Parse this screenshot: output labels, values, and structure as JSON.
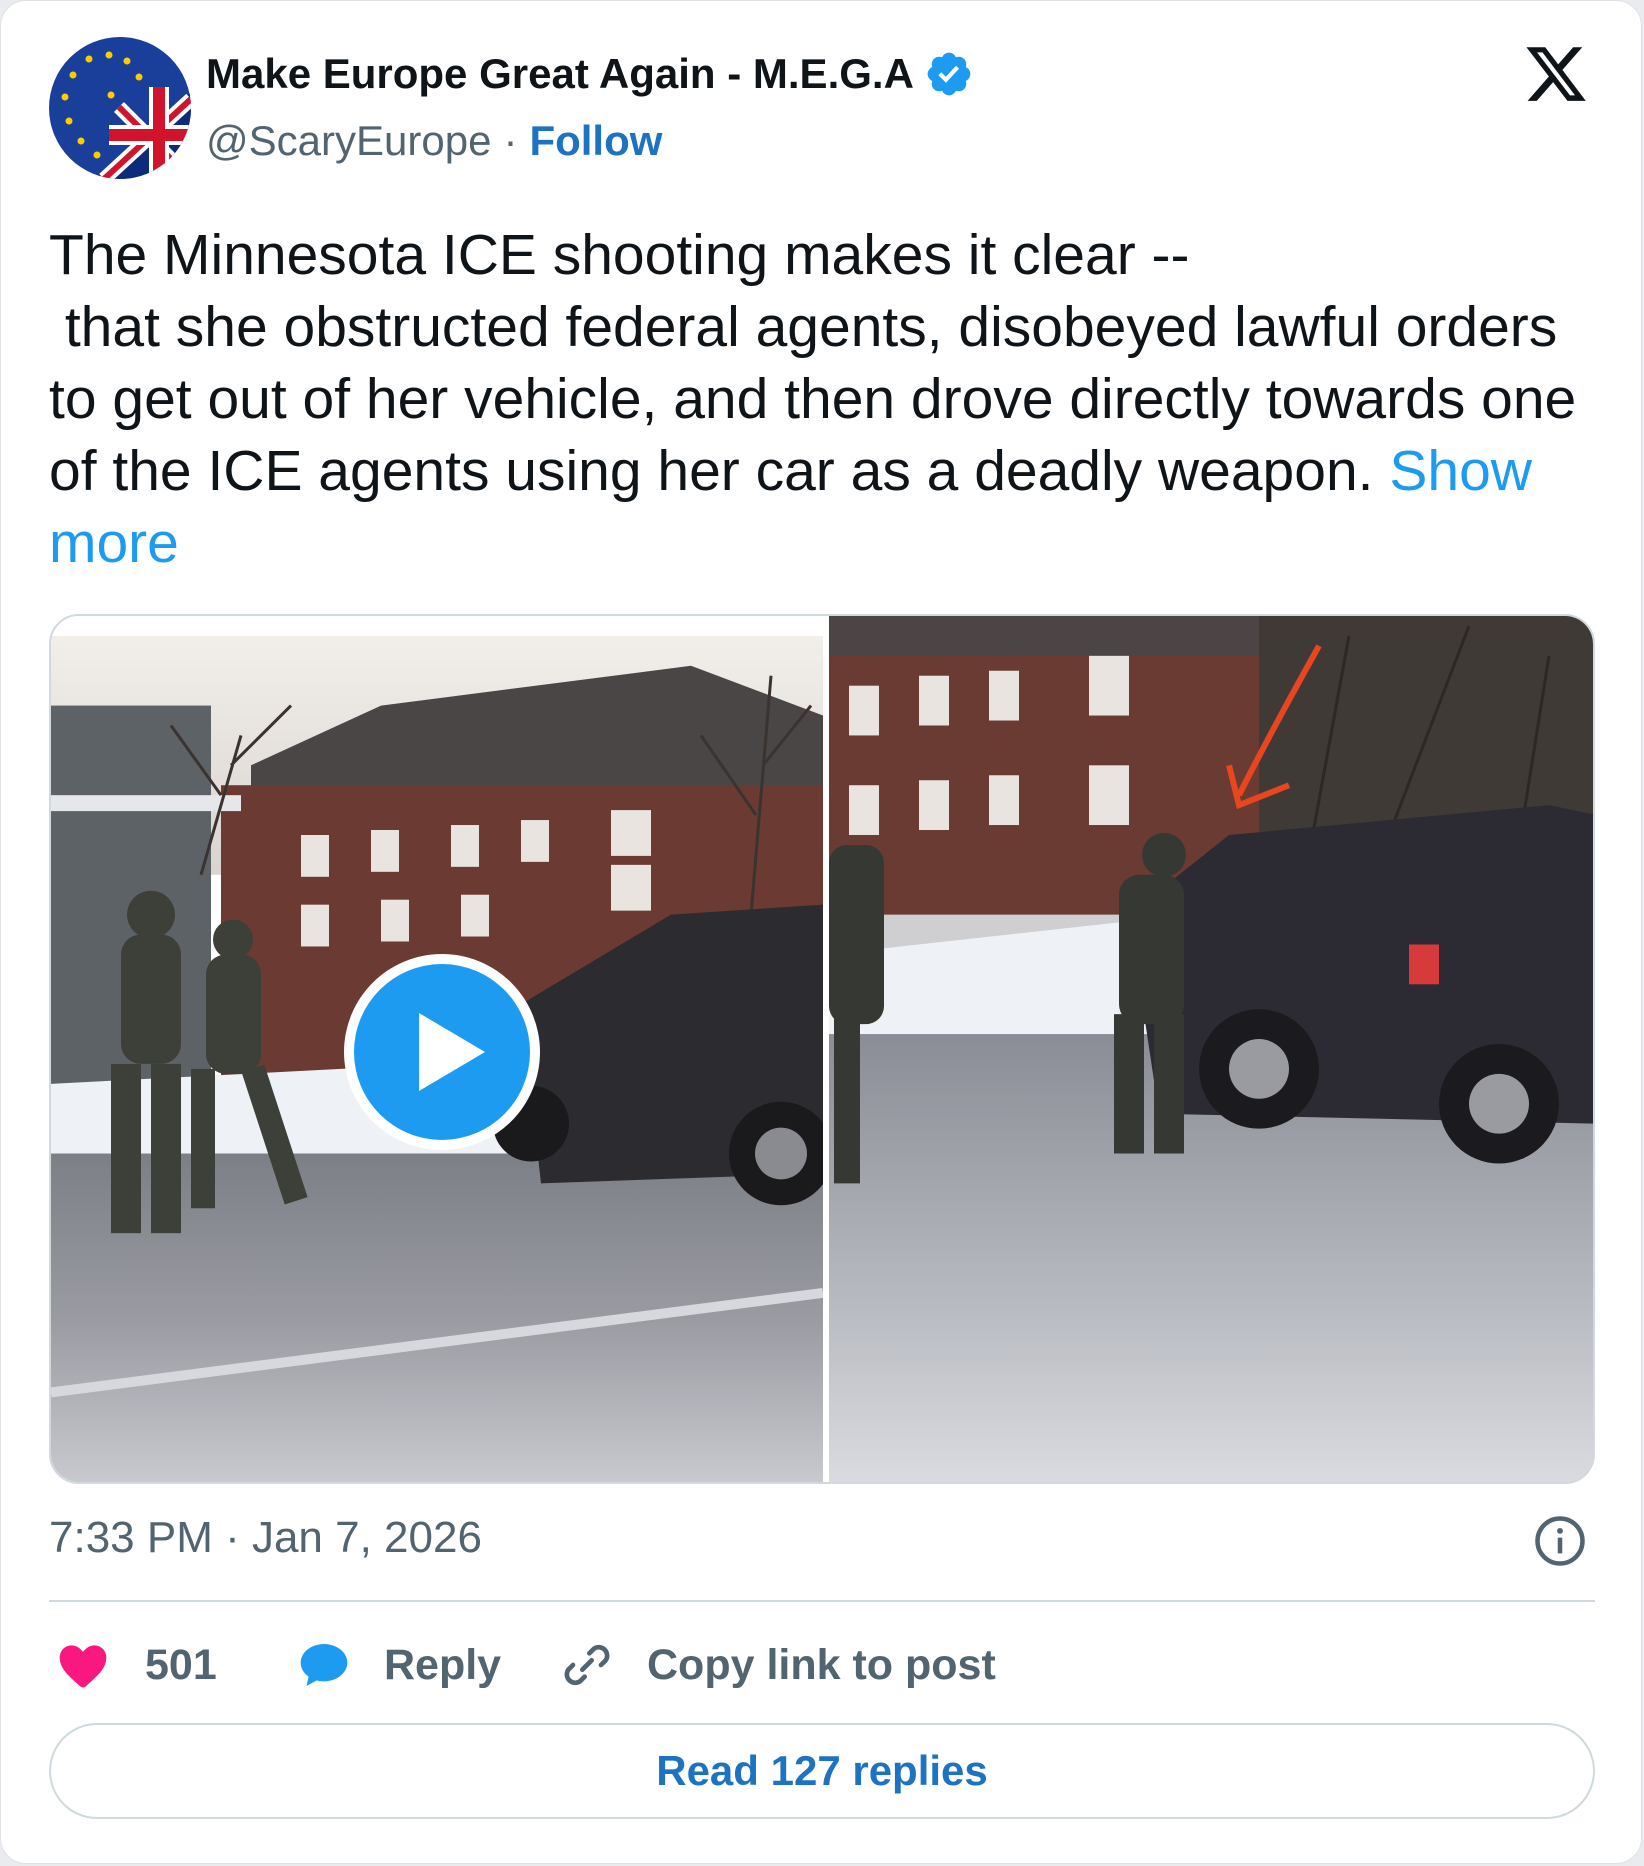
{
  "author": {
    "display_name": "Make Europe Great Again - M.E.G.A",
    "handle": "@ScaryEurope",
    "separator": "·",
    "follow_label": "Follow",
    "verified": true
  },
  "tweet": {
    "text": "The Minnesota ICE shooting makes it clear --\n that she obstructed federal agents, disobeyed lawful orders to get out of her vehicle, and then drove directly towards one of the ICE agents using her car as a deadly weapon. ",
    "show_more_label": "Show more",
    "timestamp": "7:33 PM · Jan 7, 2026"
  },
  "actions": {
    "likes_count": "501",
    "reply_label": "Reply",
    "copy_link_label": "Copy link to post"
  },
  "read_replies_label": "Read 127 replies",
  "icons": {
    "verified": "verified-badge-icon",
    "x": "x-logo-icon",
    "play": "play-icon",
    "info": "info-icon",
    "heart": "heart-icon",
    "reply": "reply-bubble-icon",
    "link": "link-icon"
  },
  "colors": {
    "link_blue": "#1d72c2",
    "show_more_blue": "#1d9bf0",
    "heart_pink": "#f91880",
    "secondary_text": "#536471",
    "annotation_arrow": "#e8461f"
  }
}
